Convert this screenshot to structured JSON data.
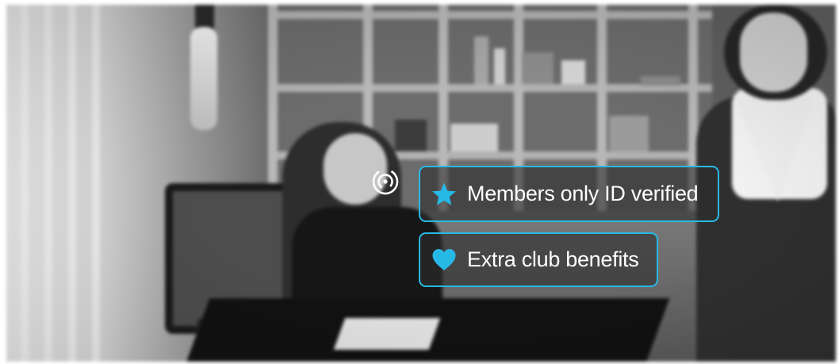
{
  "background_scene": {
    "description_icon": "blurred-office-photo"
  },
  "target_icon": {
    "icon": "target-rings-icon",
    "color": "#ffffff"
  },
  "features": [
    {
      "icon": "star-icon",
      "label": "Members only ID verified"
    },
    {
      "icon": "heart-icon",
      "label": "Extra club benefits"
    }
  ],
  "colors": {
    "accent": "#27b9e6",
    "pill_bg": "#2d2d2d",
    "text": "#ffffff"
  }
}
